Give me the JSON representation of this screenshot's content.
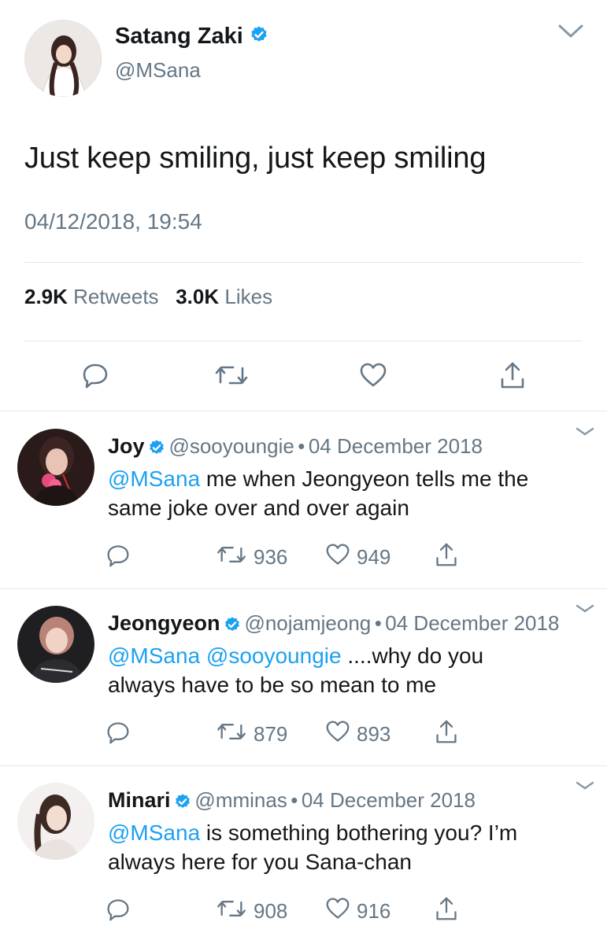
{
  "colors": {
    "accent": "#1da1f2",
    "muted": "#657786",
    "divider": "#e1e8ed",
    "text": "#14171a"
  },
  "main": {
    "name": "Satang Zaki",
    "handle": "@MSana",
    "text": "Just keep smiling, just keep smiling",
    "timestamp": "04/12/2018, 19:54",
    "retweets_count": "2.9K",
    "retweets_label": "Retweets",
    "likes_count": "3.0K",
    "likes_label": "Likes",
    "icons": [
      "reply-icon",
      "retweet-icon",
      "like-icon",
      "share-icon"
    ]
  },
  "replies": [
    {
      "name": "Joy",
      "handle": "@sooyoungie",
      "sep": "•",
      "date": "04 December 2018",
      "mention": "@MSana",
      "text_line1": " me when Jeongyeon tells me the",
      "text_line2": "same joke over and over again",
      "retweets": "936",
      "likes": "949"
    },
    {
      "name": "Jeongyeon",
      "handle": "@nojamjeong",
      "sep": "•",
      "date": "04 December 2018",
      "mention": "@MSana @sooyoungie",
      "text_line1": " ....why do you",
      "text_line2": "always have to be so mean to me",
      "retweets": "879",
      "likes": "893"
    },
    {
      "name": "Minari",
      "handle": "@mminas",
      "sep": "•",
      "date": "04 December 2018",
      "mention": "@MSana",
      "text_line1": " is something bothering you? I’m",
      "text_line2": "always here for you Sana-chan",
      "retweets": "908",
      "likes": "916"
    }
  ]
}
